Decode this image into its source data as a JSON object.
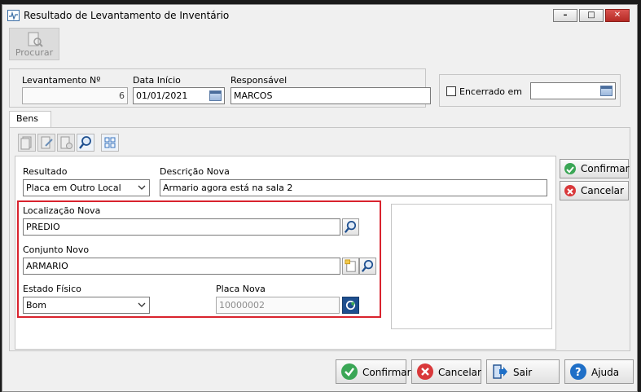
{
  "window": {
    "title": "Resultado de Levantamento de Inventário"
  },
  "toolbar": {
    "procurar_label": "Procurar"
  },
  "header": {
    "levantamento_label": "Levantamento Nº",
    "levantamento_value": "6",
    "data_inicio_label": "Data Início",
    "data_inicio_value": "01/01/2021",
    "responsavel_label": "Responsável",
    "responsavel_value": "MARCOS",
    "encerrado_label": "Encerrado em",
    "encerrado_value": ""
  },
  "tabs": [
    {
      "label": "Bens"
    }
  ],
  "form": {
    "resultado_label": "Resultado",
    "resultado_value": "Placa em Outro Local",
    "descricao_label": "Descrição Nova",
    "descricao_value": "Armario agora está na sala 2",
    "localizacao_label": "Localização Nova",
    "localizacao_value": "PREDIO",
    "conjunto_label": "Conjunto Novo",
    "conjunto_value": "ARMARIO",
    "estado_label": "Estado Físico",
    "estado_value": "Bom",
    "placa_label": "Placa Nova",
    "placa_value": "10000002"
  },
  "side_buttons": {
    "confirmar": "Confirmar",
    "cancelar": "Cancelar"
  },
  "bottom_buttons": {
    "confirmar": "Confirmar",
    "cancelar": "Cancelar",
    "sair": "Sair",
    "ajuda": "Ajuda"
  },
  "colors": {
    "highlight": "#d9232e",
    "confirm": "#3aa655",
    "cancel": "#d9383a",
    "help": "#1f6fc7"
  }
}
